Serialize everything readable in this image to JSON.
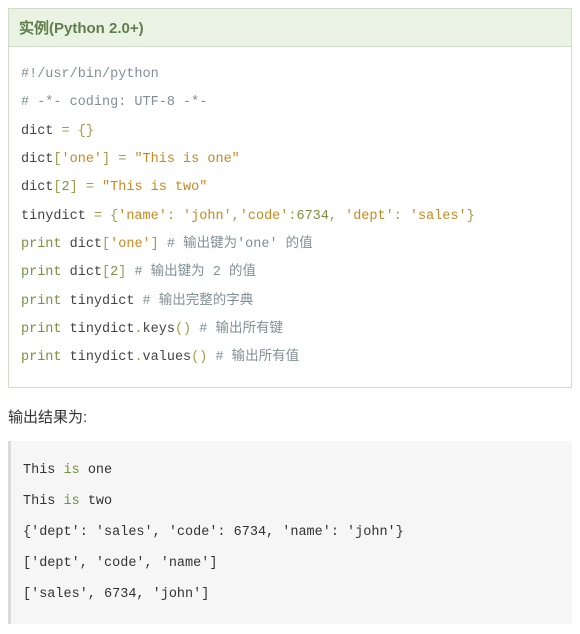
{
  "example": {
    "title": "实例(Python 2.0+)",
    "code": {
      "l1_comment": "#!/usr/bin/python",
      "l2_comment": "# -*- coding: UTF-8 -*-",
      "l3_ident": "dict",
      "l3_eq": " = ",
      "l3_brace": "{}",
      "l4_ident": "dict",
      "l4_punc1": "[",
      "l4_key": "'one'",
      "l4_punc2": "]",
      "l4_eq": " = ",
      "l4_val": "\"This is one\"",
      "l5_ident": "dict",
      "l5_punc1": "[",
      "l5_key": "2",
      "l5_punc2": "]",
      "l5_eq": " = ",
      "l5_val": "\"This is two\"",
      "l6_ident": "tinydict",
      "l6_eq": " = ",
      "l6_b1": "{",
      "l6_k1": "'name'",
      "l6_c1": ": ",
      "l6_v1": "'john'",
      "l6_cm1": ",",
      "l6_k2": "'code'",
      "l6_c2": ":",
      "l6_v2": "6734",
      "l6_cm2": ", ",
      "l6_k3": "'dept'",
      "l6_c3": ": ",
      "l6_v3": "'sales'",
      "l6_b2": "}",
      "l7_kw": "print",
      "l7_sp": " ",
      "l7_ident": "dict",
      "l7_p1": "[",
      "l7_key": "'one'",
      "l7_p2": "]",
      "l7_comment": " # 输出键为'one' 的值",
      "l8_kw": "print",
      "l8_sp": " ",
      "l8_ident": "dict",
      "l8_p1": "[",
      "l8_key": "2",
      "l8_p2": "]",
      "l8_comment": " # 输出键为 2 的值",
      "l9_kw": "print",
      "l9_sp": " ",
      "l9_ident": "tinydict",
      "l9_comment": " # 输出完整的字典",
      "l10_kw": "print",
      "l10_sp": " ",
      "l10_ident": "tinydict",
      "l10_dot": ".",
      "l10_func": "keys",
      "l10_paren": "()",
      "l10_comment": " # 输出所有键",
      "l11_kw": "print",
      "l11_sp": " ",
      "l11_ident": "tinydict",
      "l11_dot": ".",
      "l11_func": "values",
      "l11_paren": "()",
      "l11_comment": " # 输出所有值"
    }
  },
  "result_label": "输出结果为:",
  "output": {
    "l1_a": "This",
    "l1_b": " is ",
    "l1_c": "one",
    "l2_a": "This",
    "l2_b": " is ",
    "l2_c": "two",
    "l3": "{'dept': 'sales', 'code': 6734, 'name': 'john'}",
    "l4": "['dept', 'code', 'name']",
    "l5": "['sales', 6734, 'john']"
  }
}
